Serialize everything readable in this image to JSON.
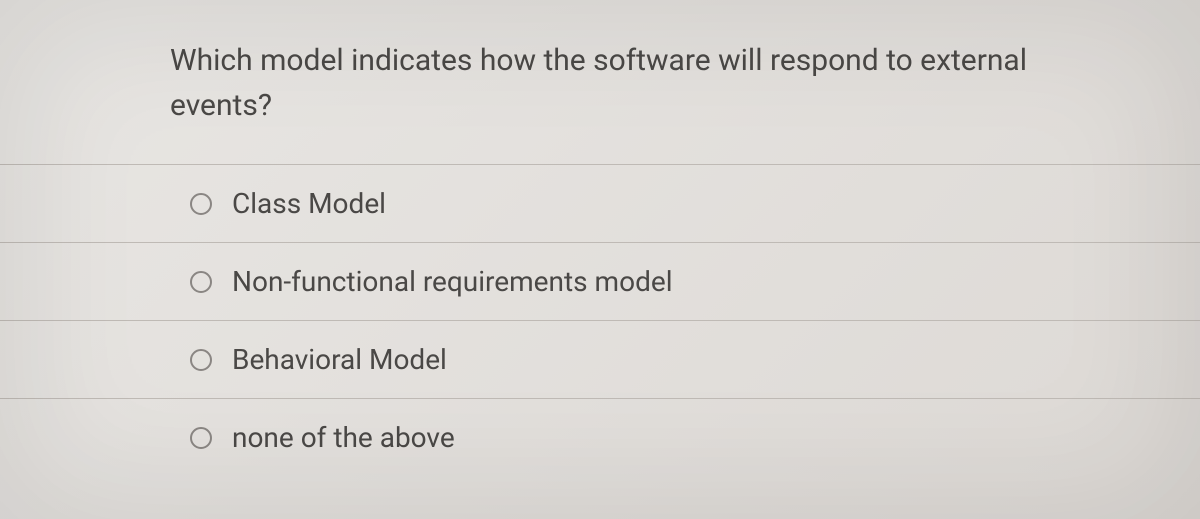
{
  "question": "Which model indicates how the software will respond to external events?",
  "options": [
    {
      "label": "Class Model"
    },
    {
      "label": "Non-functional requirements model"
    },
    {
      "label": "Behavioral Model"
    },
    {
      "label": "none of the above"
    }
  ]
}
